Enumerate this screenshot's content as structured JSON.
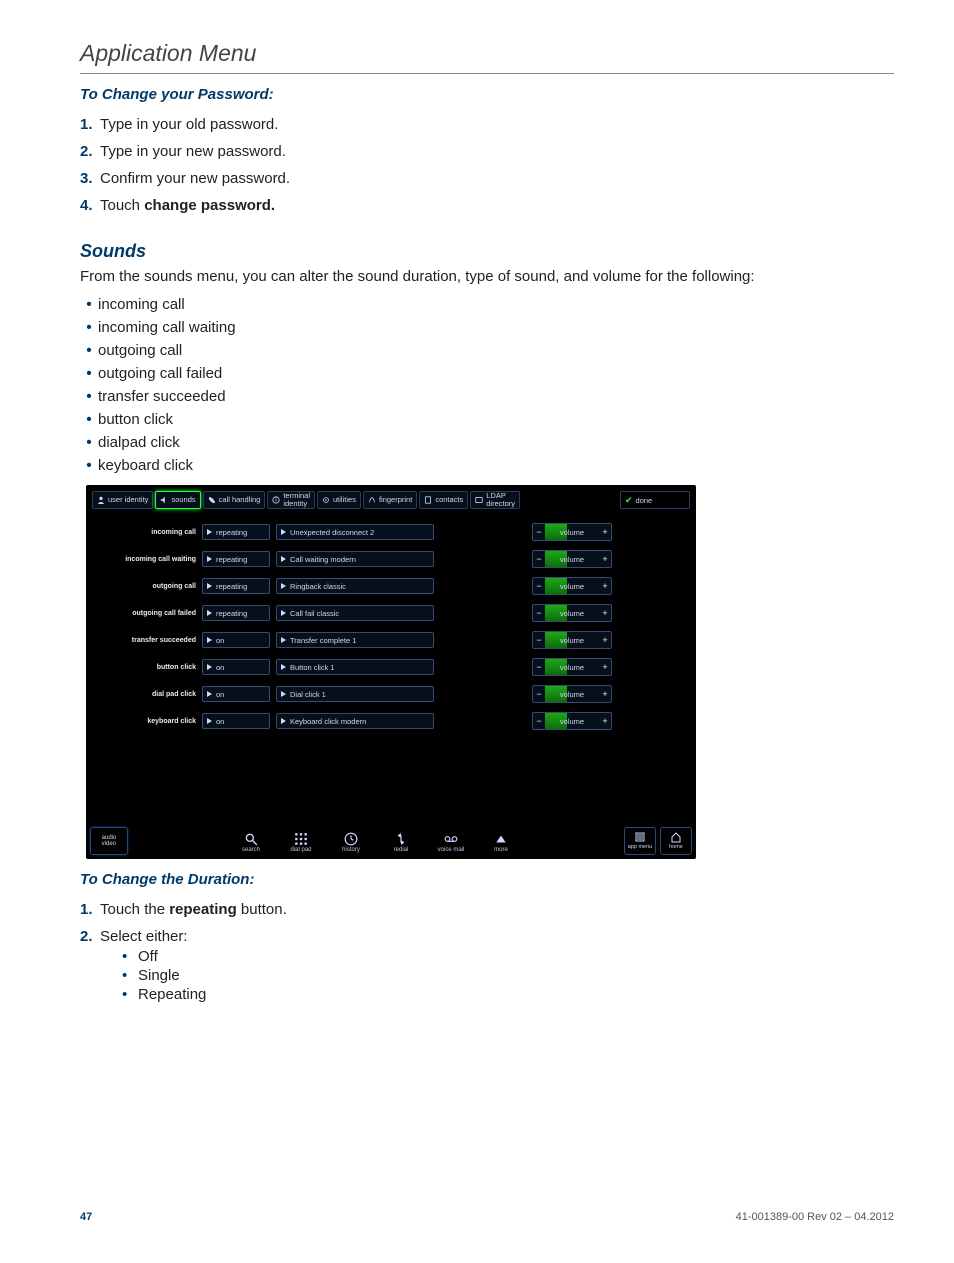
{
  "page": {
    "title": "Application Menu",
    "footer_page": "47",
    "footer_rev": "41-001389-00 Rev 02 – 04.2012"
  },
  "section_pw": {
    "heading": "To Change your Password:",
    "steps": [
      "Type in your old password.",
      "Type in your new password.",
      "Confirm your new password."
    ],
    "step4_pre": "Touch ",
    "step4_bold": "change password."
  },
  "section_sounds": {
    "heading": "Sounds",
    "intro": "From the sounds menu, you can alter the sound duration, type of sound, and volume for the following:",
    "bullets": [
      "incoming call",
      "incoming call waiting",
      "outgoing call",
      "outgoing call failed",
      "transfer succeeded",
      "button click",
      "dialpad click",
      "keyboard click"
    ]
  },
  "device": {
    "tabs": [
      "user identity",
      "sounds",
      "call handling",
      "terminal\nidentity",
      "utilities",
      "fingerprint",
      "contacts",
      "LDAP\ndirectory"
    ],
    "done": "done",
    "volume_label": "volume",
    "rows": [
      {
        "label": "incoming call",
        "mode": "repeating",
        "sound": "Unexpected disconnect 2"
      },
      {
        "label": "incoming call waiting",
        "mode": "repeating",
        "sound": "Call waiting modern"
      },
      {
        "label": "outgoing call",
        "mode": "repeating",
        "sound": "Ringback classic"
      },
      {
        "label": "outgoing call failed",
        "mode": "repeating",
        "sound": "Call fail classic"
      },
      {
        "label": "transfer succeeded",
        "mode": "on",
        "sound": "Transfer complete 1"
      },
      {
        "label": "button click",
        "mode": "on",
        "sound": "Button click 1"
      },
      {
        "label": "dial pad click",
        "mode": "on",
        "sound": "Dial click 1"
      },
      {
        "label": "keyboard click",
        "mode": "on",
        "sound": "Keyboard click modern"
      }
    ],
    "bottom": {
      "av": "audio\nvideo",
      "nav": [
        "search",
        "dial pad",
        "history",
        "redial",
        "voice mail",
        "more"
      ],
      "right": [
        "app menu",
        "home"
      ]
    }
  },
  "section_duration": {
    "heading": "To Change the Duration:",
    "step1_pre": "Touch the ",
    "step1_bold": "repeating",
    "step1_post": " button.",
    "step2": "Select either:",
    "options": [
      "Off",
      "Single",
      "Repeating"
    ]
  }
}
